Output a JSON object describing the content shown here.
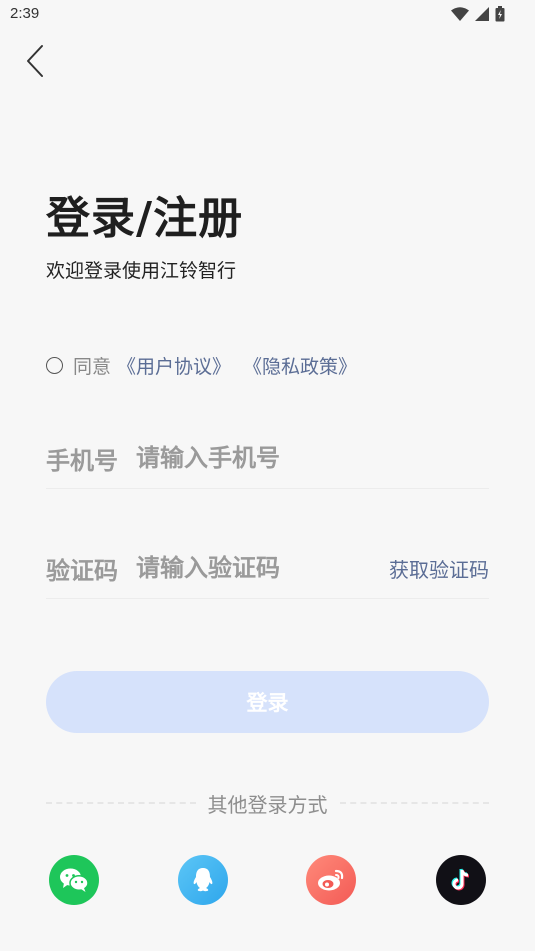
{
  "status_bar": {
    "time": "2:39",
    "icons": [
      "wifi-icon",
      "signal-icon",
      "battery-icon"
    ]
  },
  "header": {
    "back_icon": "chevron-left-icon"
  },
  "title": "登录/注册",
  "subtitle": "欢迎登录使用江铃智行",
  "agreement": {
    "prefix": "同意",
    "user_agreement": "《用户协议》",
    "privacy_policy": "《隐私政策》",
    "checked": false
  },
  "phone_field": {
    "label": "手机号",
    "placeholder": "请输入手机号",
    "value": ""
  },
  "code_field": {
    "label": "验证码",
    "placeholder": "请输入验证码",
    "value": "",
    "get_code_label": "获取验证码"
  },
  "login_button": {
    "label": "登录"
  },
  "other_login": {
    "label": "其他登录方式",
    "options": [
      "wechat-icon",
      "qq-icon",
      "weibo-icon",
      "douyin-icon"
    ]
  },
  "colors": {
    "background": "#f7f7f7",
    "link": "#5b6d95",
    "login_button_disabled": "#d6e2fb",
    "wechat": "#1ec65a",
    "qq": "#2ea6ec",
    "weibo": "#f35a55",
    "douyin": "#111016"
  }
}
